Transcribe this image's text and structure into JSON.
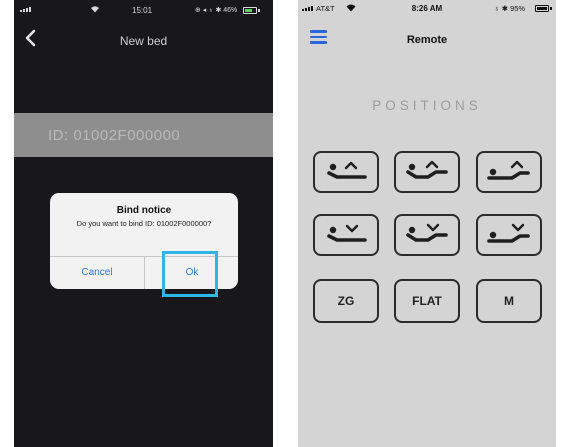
{
  "left_screen": {
    "status_bar": {
      "time": "15:01",
      "status_right": "⊕ ◂ ♁ ✱ 46%"
    },
    "nav": {
      "title": "New bed",
      "back_icon": "chevron-left-icon"
    },
    "device_id": "ID: 01002F000000",
    "dialog": {
      "title": "Bind notice",
      "message": "Do you want to bind ID: 01002F000000?",
      "cancel_label": "Cancel",
      "ok_label": "Ok"
    },
    "colors": {
      "background": "#17171c",
      "id_band": "#8e8e8e",
      "dialog_button": "#2f7ce6",
      "highlight": "#2fb6e8"
    }
  },
  "right_screen": {
    "status_bar": {
      "carrier": "AT&T",
      "time": "8:26 AM",
      "status_right": "♁ ✱ 95%"
    },
    "nav": {
      "title": "Remote",
      "menu_icon": "hamburger-menu-icon"
    },
    "section_label": "POSITIONS",
    "position_buttons": [
      {
        "name": "head-up",
        "icon": "bed-head-up-icon"
      },
      {
        "name": "back-up",
        "icon": "bed-back-up-icon"
      },
      {
        "name": "foot-up",
        "icon": "bed-foot-up-icon"
      },
      {
        "name": "head-down",
        "icon": "bed-head-down-icon"
      },
      {
        "name": "back-down",
        "icon": "bed-back-down-icon"
      },
      {
        "name": "foot-down",
        "icon": "bed-foot-down-icon"
      }
    ],
    "preset_buttons": {
      "zg": "ZG",
      "flat": "FLAT",
      "memory": "M"
    },
    "colors": {
      "background": "#d4d4d4",
      "menu": "#2467e0",
      "section_label": "#9c9c9c"
    }
  }
}
